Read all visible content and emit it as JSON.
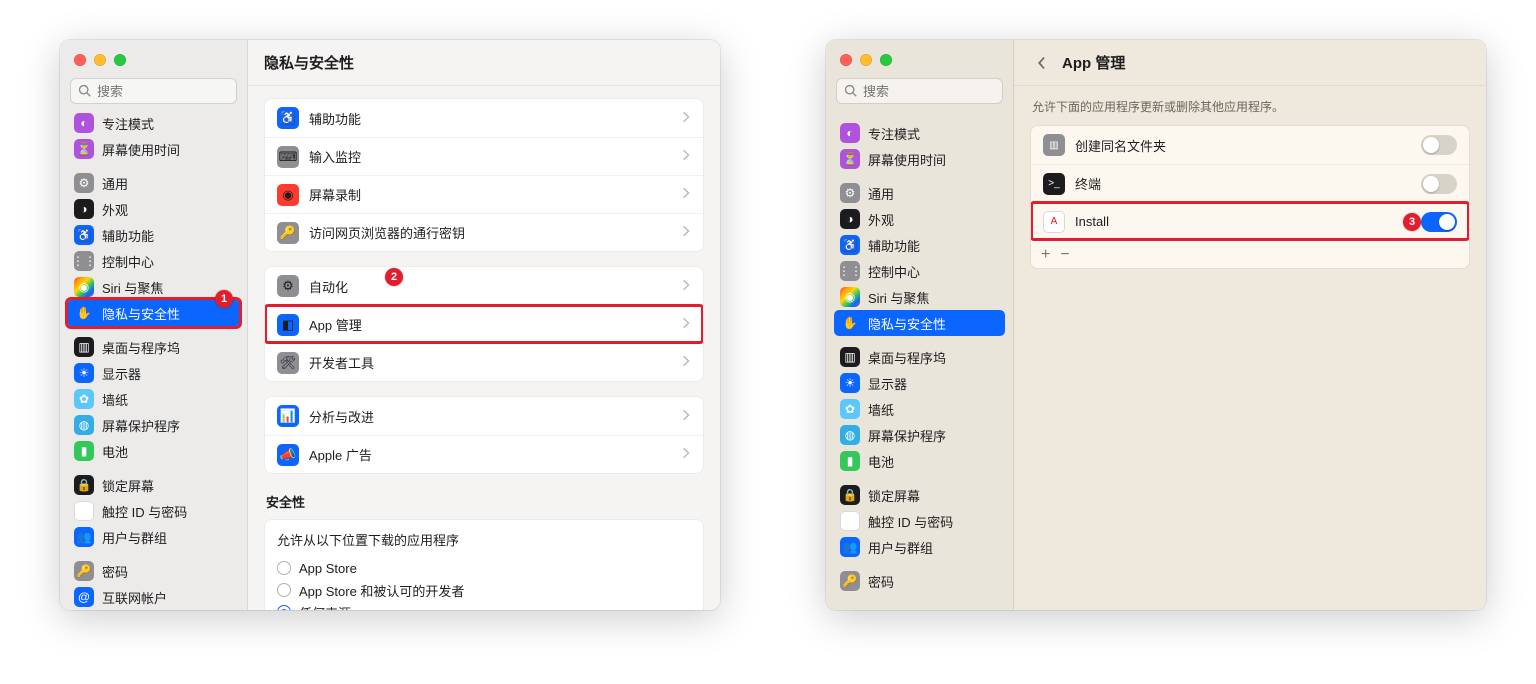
{
  "left": {
    "title": "隐私与安全性",
    "search_placeholder": "搜索",
    "annotations": {
      "sidebar_badge": "1",
      "row_badge": "2"
    },
    "sidebar": {
      "items": [
        {
          "label": "专注模式",
          "cut": true
        },
        {
          "label": "屏幕使用时间"
        },
        {
          "gap": true
        },
        {
          "label": "通用"
        },
        {
          "label": "外观"
        },
        {
          "label": "辅助功能"
        },
        {
          "label": "控制中心"
        },
        {
          "label": "Siri 与聚焦"
        },
        {
          "label": "隐私与安全性",
          "selected": true,
          "highlight": true
        },
        {
          "gap": true
        },
        {
          "label": "桌面与程序坞"
        },
        {
          "label": "显示器"
        },
        {
          "label": "墙纸"
        },
        {
          "label": "屏幕保护程序"
        },
        {
          "label": "电池"
        },
        {
          "gap": true
        },
        {
          "label": "锁定屏幕"
        },
        {
          "label": "触控 ID 与密码"
        },
        {
          "label": "用户与群组"
        },
        {
          "gap": true
        },
        {
          "label": "密码"
        },
        {
          "label": "互联网帐户"
        }
      ]
    },
    "groups": [
      {
        "rows": [
          {
            "label": "辅助功能"
          },
          {
            "label": "输入监控"
          },
          {
            "label": "屏幕录制"
          },
          {
            "label": "访问网页浏览器的通行密钥"
          }
        ]
      },
      {
        "rows": [
          {
            "label": "自动化"
          },
          {
            "label": "App 管理",
            "highlight": true
          },
          {
            "label": "开发者工具"
          }
        ]
      },
      {
        "rows": [
          {
            "label": "分析与改进"
          },
          {
            "label": "Apple 广告"
          }
        ]
      }
    ],
    "security": {
      "title": "安全性",
      "radio_title": "允许从以下位置下载的应用程序",
      "options": [
        {
          "label": "App Store",
          "checked": false
        },
        {
          "label": "App Store 和被认可的开发者",
          "checked": false
        },
        {
          "label": "任何来源",
          "checked": true
        }
      ]
    }
  },
  "right": {
    "title": "App 管理",
    "subtitle": "允许下面的应用程序更新或删除其他应用程序。",
    "search_placeholder": "搜索",
    "annotations": {
      "row_badge": "3"
    },
    "sidebar": {
      "items": [
        {
          "label": "专注模式"
        },
        {
          "label": "屏幕使用时间"
        },
        {
          "gap": true
        },
        {
          "label": "通用"
        },
        {
          "label": "外观"
        },
        {
          "label": "辅助功能"
        },
        {
          "label": "控制中心"
        },
        {
          "label": "Siri 与聚焦"
        },
        {
          "label": "隐私与安全性",
          "selected": true
        },
        {
          "gap": true
        },
        {
          "label": "桌面与程序坞"
        },
        {
          "label": "显示器"
        },
        {
          "label": "墙纸"
        },
        {
          "label": "屏幕保护程序"
        },
        {
          "label": "电池"
        },
        {
          "gap": true
        },
        {
          "label": "锁定屏幕"
        },
        {
          "label": "触控 ID 与密码"
        },
        {
          "label": "用户与群组"
        },
        {
          "gap": true
        },
        {
          "label": "密码"
        }
      ]
    },
    "apps": [
      {
        "label": "创建同名文件夹",
        "on": false
      },
      {
        "label": "终端",
        "on": false
      },
      {
        "label": "Install",
        "on": true,
        "highlight": true
      }
    ],
    "footer": {
      "add": "+",
      "remove": "−"
    }
  }
}
